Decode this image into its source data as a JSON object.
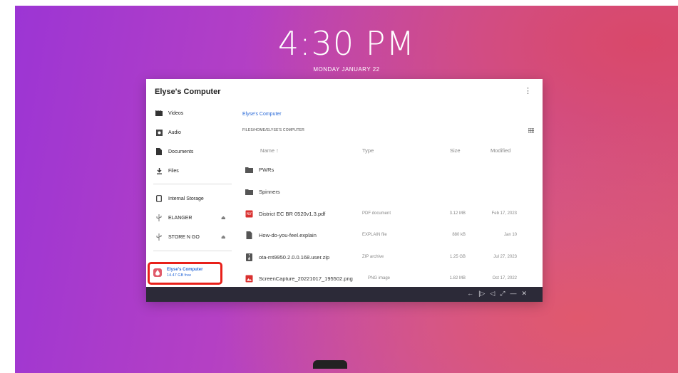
{
  "clock": {
    "time": "4:30 PM",
    "date": "MONDAY JANUARY 22"
  },
  "window": {
    "title": "Elyse's Computer",
    "menu_icon": "more-vert-icon"
  },
  "sidebar": {
    "items": [
      {
        "label": "Videos",
        "icon": "video-icon"
      },
      {
        "label": "Audio",
        "icon": "audio-icon"
      },
      {
        "label": "Documents",
        "icon": "document-icon"
      },
      {
        "label": "Files",
        "icon": "download-icon"
      },
      {
        "label": "Internal Storage",
        "icon": "phone-icon"
      },
      {
        "label": "ELANGER",
        "icon": "usb-icon",
        "eject": "⏏"
      },
      {
        "label": "STORE N GO",
        "icon": "usb-icon",
        "eject": "⏏"
      }
    ],
    "selected": {
      "label": "Elyse's Computer",
      "sub": "14.47 GB free",
      "icon": "computer-drive-icon"
    }
  },
  "main": {
    "breadcrumb": "Elyse's Computer",
    "path": "FILES/HOME/ELYSE'S COMPUTER",
    "headers": {
      "name": "Name ↑",
      "type": "Type",
      "size": "Size",
      "modified": "Modified"
    },
    "rows": [
      {
        "name": "PWRs",
        "type": "",
        "size": "",
        "modified": "",
        "icon": "folder-icon"
      },
      {
        "name": "Spinners",
        "type": "",
        "size": "",
        "modified": "",
        "icon": "folder-icon"
      },
      {
        "name": "District EC BR 0520v1.3.pdf",
        "type": "PDF document",
        "size": "3.12 MB",
        "modified": "Feb 17, 2023",
        "icon": "pdf-icon"
      },
      {
        "name": "How-do-you-feel.explain",
        "type": "EXPLAIN file",
        "size": "880 kB",
        "modified": "Jan 10",
        "icon": "file-icon"
      },
      {
        "name": "ota-mt9950.2.0.0.168.user.zip",
        "type": "ZIP archive",
        "size": "1.25 GB",
        "modified": "Jul 27, 2023",
        "icon": "zip-icon"
      },
      {
        "name": "ScreenCapture_20221017_195502.png",
        "type": "PNG image",
        "size": "1.82 MB",
        "modified": "Oct 17, 2022",
        "icon": "image-icon"
      }
    ]
  },
  "taskbar": {
    "icons": [
      "←",
      "|▷",
      "◁",
      "⤢",
      "—",
      "✕"
    ]
  },
  "colors": {
    "accent": "#2a6ad8",
    "highlight": "#e8201a",
    "taskbar": "#2c2a38"
  }
}
